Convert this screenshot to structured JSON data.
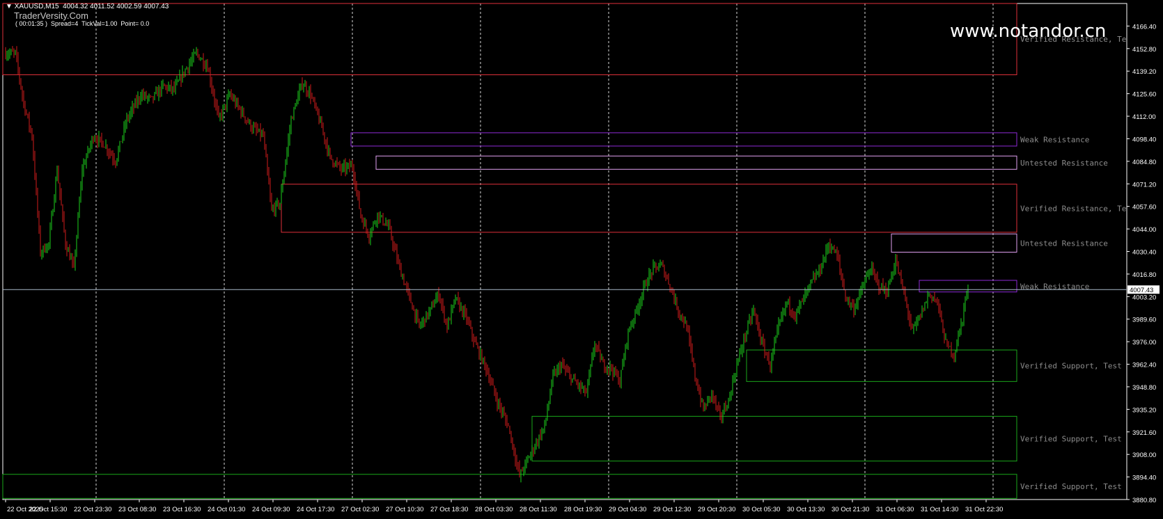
{
  "header": {
    "symbol": "XAUUSD,M15",
    "ohlc": "4004.32 4011.52 4002.59 4007.43",
    "info": "( 00:01:35 )  Spread=4  TickVal=1.00  Point= 0.0",
    "brand": "TraderVersity.Com",
    "site": "www.notandor.cn"
  },
  "colors": {
    "bg": "#000000",
    "grid": "#ffffff",
    "axis": "#ffffff",
    "up": "#1bd21b",
    "down": "#d21b1b",
    "verified_resistance": "#e0303a",
    "weak_resistance": "#8e2ad6",
    "untested_resistance": "#e0a0f0",
    "verified_support": "#1aa81a",
    "price_line": "#a8b8c8",
    "zone_label": "#8c8c8c"
  },
  "chart_data": {
    "type": "candlestick",
    "symbol": "XAUUSD",
    "timeframe": "M15",
    "ylim": [
      3880.8,
      4180.0
    ],
    "y_ticks": [
      "4166.40",
      "4152.80",
      "4139.20",
      "4125.60",
      "4112.00",
      "4098.40",
      "4084.80",
      "4071.20",
      "4057.60",
      "4044.00",
      "4030.40",
      "4016.80",
      "4003.20",
      "3989.60",
      "3976.00",
      "3962.40",
      "3948.80",
      "3935.20",
      "3921.60",
      "3908.00",
      "3894.40",
      "3880.80"
    ],
    "x_ticks": [
      "22 Oct 2025",
      "22 Oct 15:30",
      "22 Oct 23:30",
      "23 Oct 08:30",
      "23 Oct 16:30",
      "24 Oct 01:30",
      "24 Oct 09:30",
      "24 Oct 17:30",
      "27 Oct 02:30",
      "27 Oct 10:30",
      "27 Oct 18:30",
      "28 Oct 03:30",
      "28 Oct 11:30",
      "28 Oct 19:30",
      "29 Oct 04:30",
      "29 Oct 12:30",
      "29 Oct 20:30",
      "30 Oct 05:30",
      "30 Oct 13:30",
      "30 Oct 21:30",
      "31 Oct 06:30",
      "31 Oct 14:30",
      "31 Oct 22:30"
    ],
    "current_price": "4007.43",
    "price_path": [
      [
        0,
        4150
      ],
      [
        8,
        4150
      ],
      [
        14,
        4120
      ],
      [
        20,
        4100
      ],
      [
        26,
        4030
      ],
      [
        32,
        4035
      ],
      [
        38,
        4080
      ],
      [
        44,
        4035
      ],
      [
        50,
        4020
      ],
      [
        56,
        4080
      ],
      [
        64,
        4100
      ],
      [
        72,
        4095
      ],
      [
        80,
        4085
      ],
      [
        88,
        4110
      ],
      [
        98,
        4125
      ],
      [
        106,
        4122
      ],
      [
        114,
        4130
      ],
      [
        122,
        4128
      ],
      [
        130,
        4140
      ],
      [
        138,
        4150
      ],
      [
        146,
        4142
      ],
      [
        154,
        4110
      ],
      [
        162,
        4125
      ],
      [
        170,
        4115
      ],
      [
        178,
        4105
      ],
      [
        186,
        4100
      ],
      [
        192,
        4055
      ],
      [
        198,
        4060
      ],
      [
        206,
        4110
      ],
      [
        214,
        4132
      ],
      [
        220,
        4125
      ],
      [
        228,
        4105
      ],
      [
        234,
        4087
      ],
      [
        242,
        4080
      ],
      [
        250,
        4082
      ],
      [
        256,
        4052
      ],
      [
        262,
        4040
      ],
      [
        268,
        4053
      ],
      [
        276,
        4045
      ],
      [
        284,
        4020
      ],
      [
        292,
        4000
      ],
      [
        298,
        3985
      ],
      [
        306,
        3995
      ],
      [
        312,
        4005
      ],
      [
        318,
        3985
      ],
      [
        324,
        4002
      ],
      [
        332,
        3990
      ],
      [
        338,
        3975
      ],
      [
        346,
        3960
      ],
      [
        354,
        3940
      ],
      [
        362,
        3925
      ],
      [
        370,
        3895
      ],
      [
        376,
        3905
      ],
      [
        382,
        3915
      ],
      [
        388,
        3925
      ],
      [
        394,
        3955
      ],
      [
        400,
        3962
      ],
      [
        406,
        3955
      ],
      [
        412,
        3950
      ],
      [
        418,
        3945
      ],
      [
        424,
        3975
      ],
      [
        430,
        3962
      ],
      [
        436,
        3960
      ],
      [
        442,
        3952
      ],
      [
        448,
        3982
      ],
      [
        454,
        3995
      ],
      [
        460,
        4010
      ],
      [
        466,
        4020
      ],
      [
        472,
        4022
      ],
      [
        478,
        4010
      ],
      [
        484,
        3995
      ],
      [
        490,
        3985
      ],
      [
        496,
        3955
      ],
      [
        502,
        3935
      ],
      [
        508,
        3945
      ],
      [
        514,
        3930
      ],
      [
        520,
        3940
      ],
      [
        526,
        3962
      ],
      [
        532,
        3980
      ],
      [
        538,
        3995
      ],
      [
        544,
        3975
      ],
      [
        550,
        3962
      ],
      [
        556,
        3985
      ],
      [
        562,
        4000
      ],
      [
        568,
        3992
      ],
      [
        574,
        4002
      ],
      [
        580,
        4012
      ],
      [
        586,
        4020
      ],
      [
        592,
        4035
      ],
      [
        598,
        4028
      ],
      [
        604,
        4003
      ],
      [
        610,
        3996
      ],
      [
        616,
        4008
      ],
      [
        622,
        4020
      ],
      [
        628,
        4010
      ],
      [
        634,
        4006
      ],
      [
        640,
        4025
      ],
      [
        646,
        4005
      ],
      [
        652,
        3982
      ],
      [
        658,
        3992
      ],
      [
        664,
        4005
      ],
      [
        670,
        4000
      ],
      [
        676,
        3975
      ],
      [
        682,
        3968
      ],
      [
        688,
        3990
      ],
      [
        690,
        4003
      ],
      [
        692,
        4005
      ]
    ],
    "zones": [
      {
        "type": "verified_resistance",
        "label": "Verified Resistance, Te",
        "top": 4185.0,
        "bottom": 4137.0,
        "start": 0
      },
      {
        "type": "weak_resistance",
        "label": "Weak Resistance",
        "top": 4102.0,
        "bottom": 4094.0,
        "start": 248
      },
      {
        "type": "untested_resistance",
        "label": "Untested Resistance",
        "top": 4088.0,
        "bottom": 4080.0,
        "start": 266
      },
      {
        "type": "verified_resistance",
        "label": "Verified Resistance, Te",
        "top": 4071.0,
        "bottom": 4042.0,
        "start": 198
      },
      {
        "type": "untested_resistance",
        "label": "Untested Resistance",
        "top": 4041.0,
        "bottom": 4030.0,
        "start": 636
      },
      {
        "type": "weak_resistance",
        "label": "Weak Resistance",
        "top": 4013.0,
        "bottom": 4006.0,
        "start": 656
      },
      {
        "type": "verified_support",
        "label": "Verified Support, Test",
        "top": 3971.0,
        "bottom": 3952.0,
        "start": 532
      },
      {
        "type": "verified_support",
        "label": "Verified Support, Test",
        "top": 3931.0,
        "bottom": 3904.0,
        "start": 378
      },
      {
        "type": "verified_support",
        "label": "Verified Support, Test",
        "top": 3896.0,
        "bottom": 3881.5,
        "start": 0
      }
    ]
  }
}
